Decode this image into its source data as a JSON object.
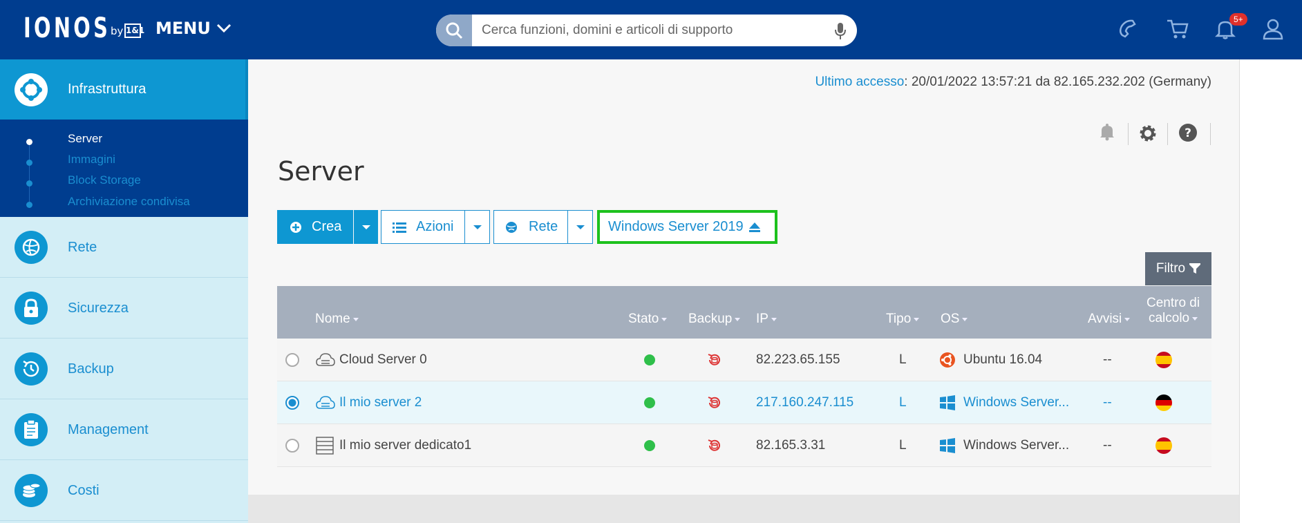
{
  "topbar": {
    "logo": "IONOS",
    "logo_by": "by",
    "logo_brand": "1&1",
    "menu_label": "MENU",
    "search_placeholder": "Cerca funzioni, domini e articoli di supporto",
    "notification_badge": "5+"
  },
  "sidebar": {
    "active": {
      "label": "Infrastruttura",
      "icon": "infrastructure-icon"
    },
    "subitems": [
      {
        "label": "Server",
        "active": true
      },
      {
        "label": "Immagini",
        "active": false
      },
      {
        "label": "Block Storage",
        "active": false
      },
      {
        "label": "Archiviazione condivisa",
        "active": false
      }
    ],
    "items": [
      {
        "label": "Rete",
        "icon": "network-icon"
      },
      {
        "label": "Sicurezza",
        "icon": "lock-icon"
      },
      {
        "label": "Backup",
        "icon": "clock-icon"
      },
      {
        "label": "Management",
        "icon": "clipboard-icon"
      },
      {
        "label": "Costi",
        "icon": "coins-icon"
      }
    ]
  },
  "main": {
    "last_access_label": "Ultimo accesso",
    "last_access_value": ": 20/01/2022 13:57:21 da 82.165.232.202 (Germany)",
    "page_title": "Server",
    "toolbar": {
      "create": "Crea",
      "actions": "Azioni",
      "network": "Rete",
      "selected_os": "Windows Server 2019"
    },
    "filter_label": "Filtro"
  },
  "table": {
    "headers": {
      "name": "Nome",
      "status": "Stato",
      "backup": "Backup",
      "ip": "IP",
      "type": "Tipo",
      "os": "OS",
      "alerts": "Avvisi",
      "datacenter_1": "Centro di",
      "datacenter_2": "calcolo"
    },
    "rows": [
      {
        "name": "Cloud Server 0",
        "ip": "82.223.65.155",
        "type": "L",
        "os": "Ubuntu 16.04",
        "os_icon": "ubuntu-icon",
        "alerts": "--",
        "flag": "spain-flag-icon",
        "selected": false,
        "server_icon": "cloud-server-icon"
      },
      {
        "name": "Il mio server 2",
        "ip": "217.160.247.115",
        "type": "L",
        "os": "Windows Server...",
        "os_icon": "windows-icon",
        "alerts": "--",
        "flag": "germany-flag-icon",
        "selected": true,
        "server_icon": "cloud-server-icon"
      },
      {
        "name": "Il mio server dedicato1",
        "ip": "82.165.3.31",
        "type": "L",
        "os": "Windows Server...",
        "os_icon": "windows-icon",
        "alerts": "--",
        "flag": "spain-flag-icon",
        "selected": false,
        "server_icon": "dedicated-server-icon"
      }
    ]
  },
  "colors": {
    "header_blue": "#003d8f",
    "accent_blue": "#0e97d2",
    "highlight_green": "#1dc11d",
    "status_green": "#2fbf4a"
  }
}
